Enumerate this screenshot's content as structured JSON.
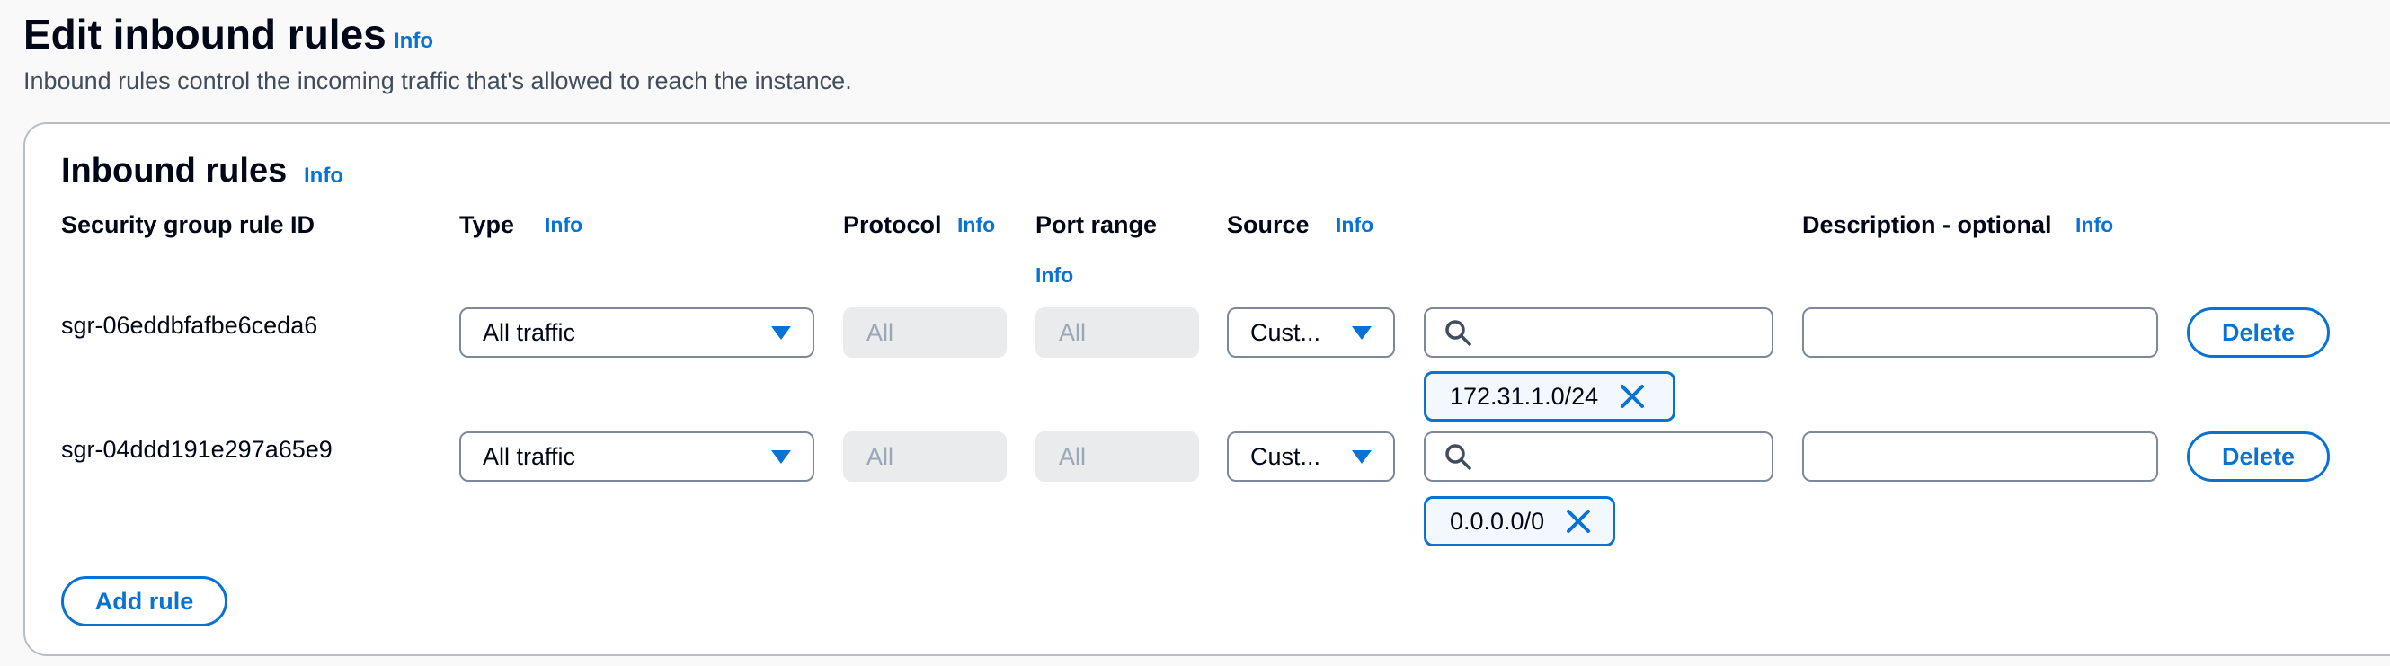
{
  "header": {
    "title": "Edit inbound rules",
    "info": "Info",
    "description": "Inbound rules control the incoming traffic that's allowed to reach the instance."
  },
  "panel": {
    "title": "Inbound rules",
    "info": "Info",
    "columns": {
      "rule_id": "Security group rule ID",
      "type": "Type",
      "type_info": "Info",
      "protocol": "Protocol",
      "protocol_info": "Info",
      "port_range": "Port range",
      "port_range_info": "Info",
      "source": "Source",
      "source_info": "Info",
      "description": "Description - optional",
      "description_info": "Info"
    },
    "rules": [
      {
        "id": "sgr-06eddbfafbe6ceda6",
        "type": "All traffic",
        "protocol": "All",
        "port_range": "All",
        "source_type": "Cust...",
        "search_value": "",
        "cidr": "172.31.1.0/24",
        "description": "",
        "delete_label": "Delete"
      },
      {
        "id": "sgr-04ddd191e297a65e9",
        "type": "All traffic",
        "protocol": "All",
        "port_range": "All",
        "source_type": "Cust...",
        "search_value": "",
        "cidr": "0.0.0.0/0",
        "description": "",
        "delete_label": "Delete"
      }
    ],
    "add_rule_label": "Add rule"
  },
  "icons": {
    "search": "search-icon",
    "dropdown": "caret-down-icon",
    "remove": "close-icon"
  },
  "colors": {
    "accent": "#0972d3",
    "text": "#000716",
    "disabled_bg": "#e9ebed",
    "border": "#7d8998"
  }
}
